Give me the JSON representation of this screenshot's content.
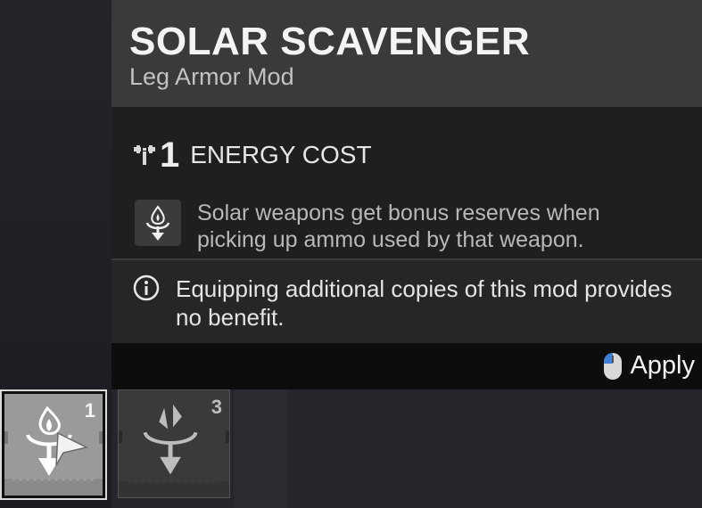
{
  "tooltip": {
    "title": "SOLAR SCAVENGER",
    "subtitle": "Leg Armor Mod",
    "energy_cost": {
      "value": "1",
      "label": "ENERGY COST",
      "icon": "energy-cost-icon"
    },
    "perk": {
      "icon": "solar-ammo-icon",
      "description": "Solar weapons get bonus reserves when picking up ammo used by that weapon."
    },
    "note": {
      "icon": "info-icon",
      "text": "Equipping additional copies of this mod provides no benefit."
    },
    "footer": {
      "action_icon": "mouse-left-click-icon",
      "action_label": "Apply"
    }
  },
  "mod_slots": [
    {
      "name": "solar-scavenger",
      "cost": "1",
      "selected": true,
      "icon": "solar-ammo-icon"
    },
    {
      "name": "arc-mod",
      "cost": "3",
      "selected": false,
      "icon": "arc-ammo-icon"
    }
  ],
  "colors": {
    "header_bg": "#3a3a3a",
    "body_bg": "#1f1f1f",
    "footer_bg": "#0d0d0d",
    "selected_border": "#d9d9d9"
  }
}
